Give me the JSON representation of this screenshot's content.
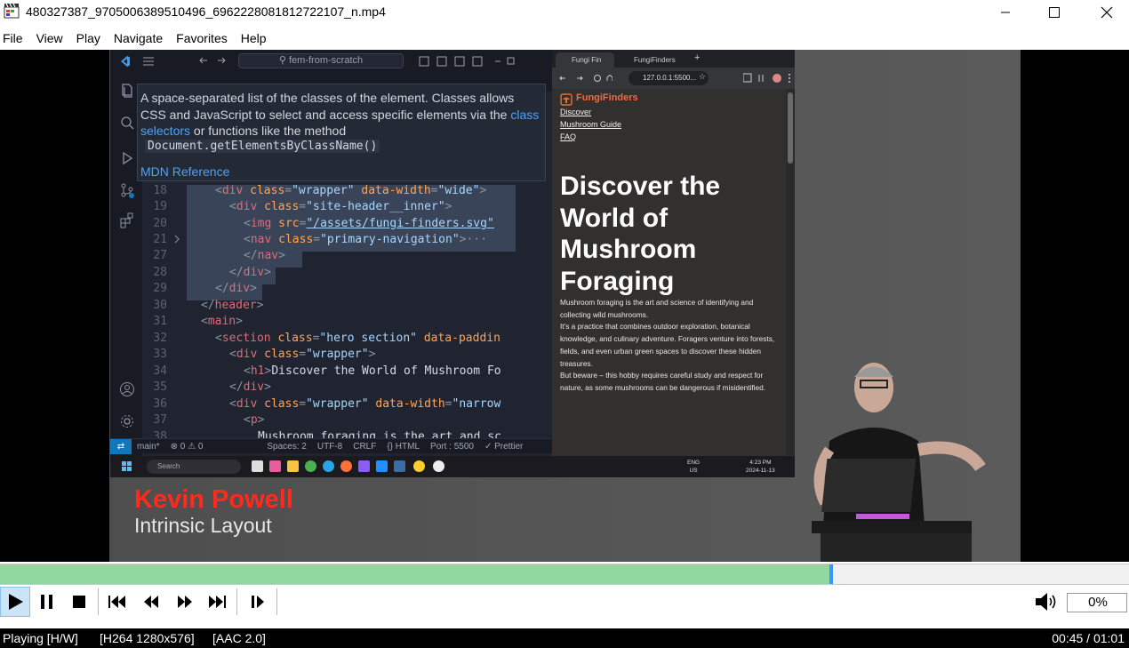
{
  "window": {
    "title": "480327387_9705006389510496_6962228081812722107_n.mp4",
    "app_icon": "clapperboard-icon"
  },
  "menu": [
    "File",
    "View",
    "Play",
    "Navigate",
    "Favorites",
    "Help"
  ],
  "video": {
    "vscode": {
      "search": "fem-from-scratch",
      "tooltip_text_1": "A space-separated list of the classes of the element. Classes allows CSS and JavaScript to select and access specific elements via the ",
      "tooltip_link_1": "class selectors",
      "tooltip_text_2": " or functions like the method",
      "tooltip_method": "Document.getElementsByClassName()",
      "tooltip_dot": ".",
      "tooltip_mdn": "MDN Reference",
      "line_numbers": [
        "18",
        "19",
        "20",
        "21",
        "27",
        "28",
        "29",
        "30",
        "31",
        "32",
        "33",
        "34",
        "35",
        "36",
        "37",
        "38"
      ],
      "status": {
        "branch": "main*",
        "problems": "⊗ 0 ⚠ 0",
        "spaces": "Spaces: 2",
        "encoding": "UTF-8",
        "eol": "CRLF",
        "language": "{} HTML",
        "port": "Port : 5500",
        "prettier": "✓ Prettier"
      }
    },
    "browser": {
      "tab1": "Fungi Fin",
      "tab2": "FungiFinders",
      "url": "127.0.0.1:5500...",
      "brand": "FungiFinders",
      "nav": [
        "Discover",
        "Mushroom Guide",
        "FAQ"
      ],
      "hero_title": "Discover the World of Mushroom Foraging",
      "hero_p1": "Mushroom foraging is the art and science of identifying and collecting wild mushrooms.",
      "hero_p2": "It's a practice that combines outdoor exploration, botanical knowledge, and culinary adventure. Foragers venture into forests, fields, and even urban green spaces to discover these hidden treasures.",
      "hero_p3": "But beware – this hobby requires careful study and respect for nature, as some mushrooms can be dangerous if misidentified."
    },
    "taskbar": {
      "search": "Search",
      "lang": "ENG\nUS",
      "clock": "4:23 PM\n2024-11-13"
    },
    "lower_third": {
      "name": "Kevin Powell",
      "title": "Intrinsic Layout"
    }
  },
  "playback": {
    "progress": 0.736,
    "volume": "0%"
  },
  "status": {
    "state": "Playing [H/W]",
    "video": "[H264 1280x576]",
    "audio": "[AAC 2.0]",
    "time": "00:45 / 01:01"
  },
  "colors": {
    "seek_fill": "#90d8a0",
    "seek_head": "#3399ff",
    "presenter_name": "#ff2a1a",
    "brand": "#f06a3a",
    "link": "#4aa3ff"
  }
}
